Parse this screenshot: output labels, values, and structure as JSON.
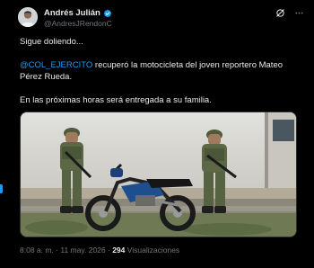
{
  "author": {
    "display_name": "Andrés Julián",
    "handle": "@AndresJRendonC"
  },
  "tweet": {
    "line1": "Sigue doliendo...",
    "mention": "@COL_EJERCITO",
    "line2_rest": " recuperó la motocicleta del joven reportero Mateo Pérez Rueda.",
    "line3": "En las próximas horas será entregada a su familia."
  },
  "meta": {
    "time": "8:08 a. m.",
    "separator1": " · ",
    "date": "11 may. 2026",
    "separator2": " · ",
    "views_count": "294",
    "views_label": " Visualizaciones"
  },
  "colors": {
    "accent": "#1d9bf0",
    "background": "#000000",
    "text": "#e7e9ea",
    "muted": "#71767b"
  },
  "icons": {
    "verified": "verified-badge-icon",
    "grok": "grok-icon",
    "more": "more-options-icon"
  }
}
